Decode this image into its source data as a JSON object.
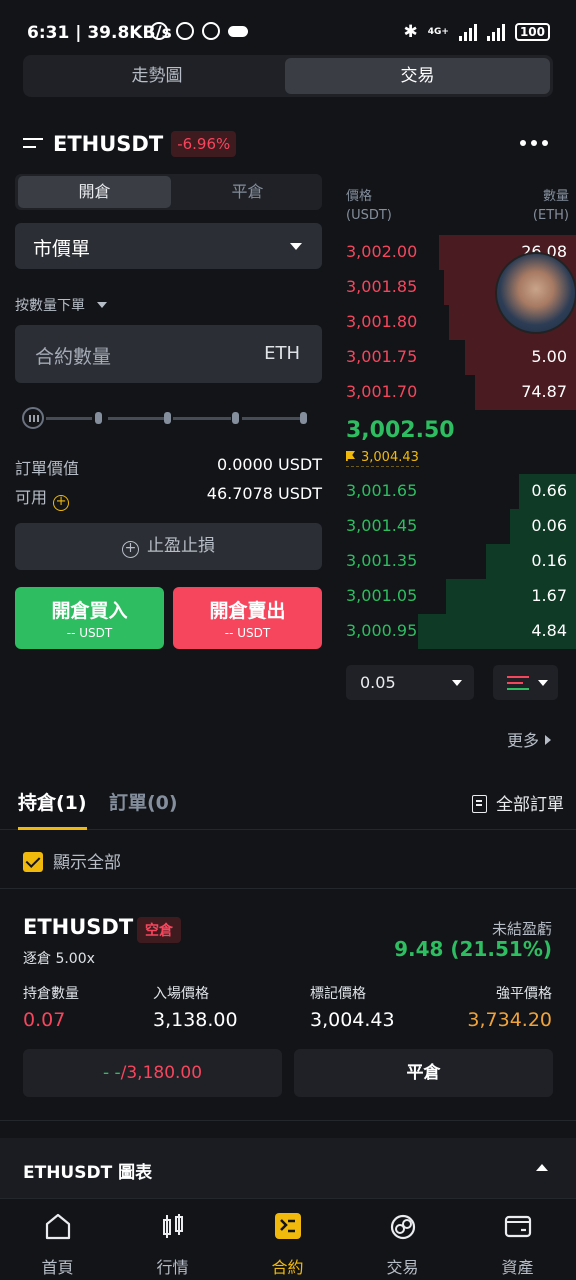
{
  "status_bar": {
    "time": "6:31",
    "speed": "39.8KB/s",
    "network_type": "4G+",
    "battery": "100"
  },
  "top_tabs": [
    {
      "label": "走勢圖",
      "active": false
    },
    {
      "label": "交易",
      "active": true
    }
  ],
  "header": {
    "symbol": "ETHUSDT",
    "change": "-6.96%"
  },
  "order_form": {
    "tabs": [
      {
        "label": "開倉",
        "active": true
      },
      {
        "label": "平倉",
        "active": false
      }
    ],
    "order_type": "市價單",
    "qty_mode": "按數量下單",
    "qty_placeholder": "合約數量",
    "qty_unit": "ETH",
    "order_value_label": "訂單價值",
    "order_value": "0.0000 USDT",
    "available_label": "可用",
    "available": "46.7078 USDT",
    "tpsl_label": "止盈止損",
    "buy_label": "開倉買入",
    "buy_sub": "-- USDT",
    "sell_label": "開倉賣出",
    "sell_sub": "-- USDT"
  },
  "order_book": {
    "price_header": "價格",
    "price_unit": "(USDT)",
    "qty_header": "數量",
    "qty_unit": "(ETH)",
    "asks": [
      {
        "price": "3,002.00",
        "qty": "26.08",
        "depth": 0.58
      },
      {
        "price": "3,001.85",
        "qty": "",
        "depth": 0.56
      },
      {
        "price": "3,001.80",
        "qty": "",
        "depth": 0.54
      },
      {
        "price": "3,001.75",
        "qty": "5.00",
        "depth": 0.47
      },
      {
        "price": "3,001.70",
        "qty": "74.87",
        "depth": 0.43
      }
    ],
    "last_price": "3,002.50",
    "mark_price": "3,004.43",
    "bids": [
      {
        "price": "3,001.65",
        "qty": "0.66",
        "depth": 0.24
      },
      {
        "price": "3,001.45",
        "qty": "0.06",
        "depth": 0.28
      },
      {
        "price": "3,001.35",
        "qty": "0.16",
        "depth": 0.38
      },
      {
        "price": "3,001.05",
        "qty": "1.67",
        "depth": 0.55
      },
      {
        "price": "3,000.95",
        "qty": "4.84",
        "depth": 0.67
      }
    ],
    "tick_size": "0.05",
    "more_label": "更多"
  },
  "positions": {
    "tab_positions": "持倉(1)",
    "tab_orders": "訂單(0)",
    "all_orders_label": "全部訂單",
    "show_all_label": "顯示全部",
    "card": {
      "symbol": "ETHUSDT",
      "side": "空倉",
      "leverage": "逐倉 5.00x",
      "upnl_label": "未結盈虧",
      "upnl_value": "9.48 (21.51%)",
      "size_label": "持倉數量",
      "size_value": "0.07",
      "entry_label": "入場價格",
      "entry_value": "3,138.00",
      "mark_label": "標記價格",
      "mark_value": "3,004.43",
      "liq_label": "強平價格",
      "liq_value": "3,734.20",
      "tpsl_prefix": "- -",
      "tpsl_value": "/3,180.00",
      "close_label": "平倉"
    }
  },
  "chart_section": {
    "title": "ETHUSDT 圖表"
  },
  "bottom_nav": [
    {
      "label": "首頁",
      "icon": "home-icon",
      "active": false
    },
    {
      "label": "行情",
      "icon": "market-icon",
      "active": false
    },
    {
      "label": "合約",
      "icon": "futures-icon",
      "active": true
    },
    {
      "label": "交易",
      "icon": "trade-icon",
      "active": false
    },
    {
      "label": "資產",
      "icon": "wallet-icon",
      "active": false
    }
  ],
  "colors": {
    "green": "#2ebd60",
    "red": "#f6465d",
    "accent": "#f0b90b",
    "background": "#121418"
  }
}
